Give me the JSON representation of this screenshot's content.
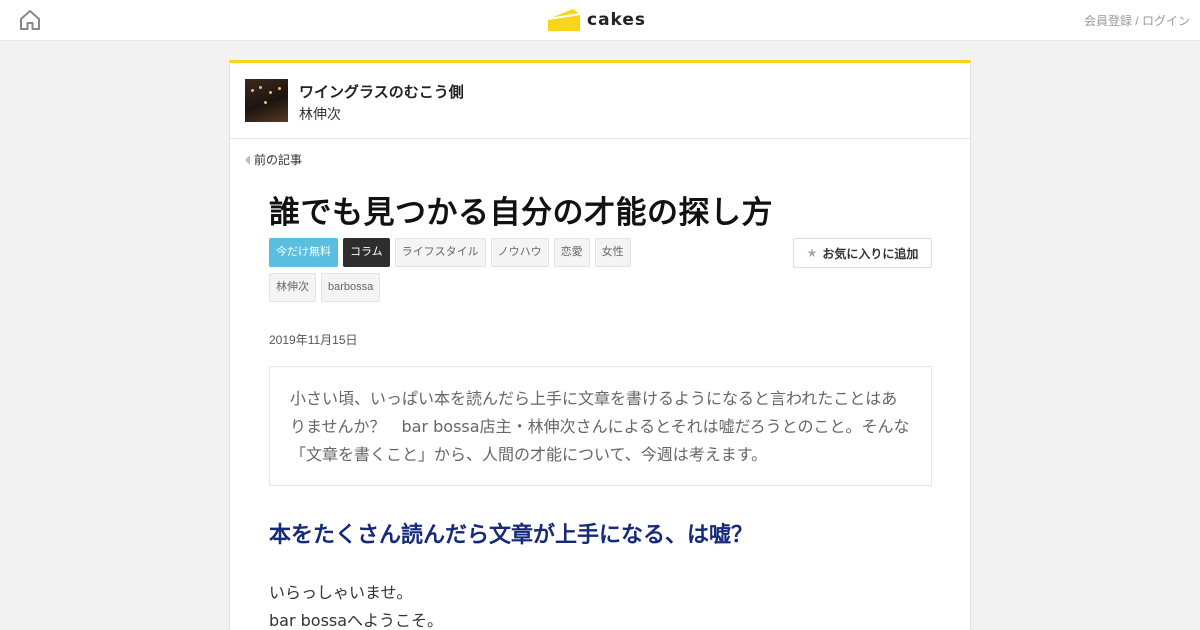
{
  "header": {
    "home_icon": "home-icon",
    "logo_text": "cakes",
    "logo_color": "#f8d51c",
    "auth_register": "会員登録",
    "auth_separator": " / ",
    "auth_login": "ログイン"
  },
  "series": {
    "title": "ワイングラスのむこう側",
    "author": "林伸次"
  },
  "nav": {
    "prev_label": "前の記事"
  },
  "article": {
    "title": "誰でも見つかる自分の才能の探し方",
    "tags": [
      "今だけ無料",
      "コラム",
      "ライフスタイル",
      "ノウハウ",
      "恋愛",
      "女性",
      "林伸次",
      "barbossa"
    ],
    "favorite_label": "お気に入りに追加",
    "date": "2019年11月15日",
    "lead_lines": [
      "小さい頃、いっぱい本を読んだら上手に文章を書けるようになると言われたことはあ",
      "りませんか？　bar bossa店主・林伸次さんによるとそれは嘘だろうとのこと。そんな",
      "「文章を書くこと」から、人間の才能について、今週は考えます。"
    ],
    "heading": "本をたくさん読んだら文章が上手になる、は嘘？",
    "body_lines": [
      "いらっしゃいませ。",
      "bar bossaへようこそ。"
    ]
  },
  "colors": {
    "accent": "#f8d51c",
    "tag_free": "#58bfde",
    "tag_column": "#2e2e2e",
    "heading": "#152a78"
  }
}
